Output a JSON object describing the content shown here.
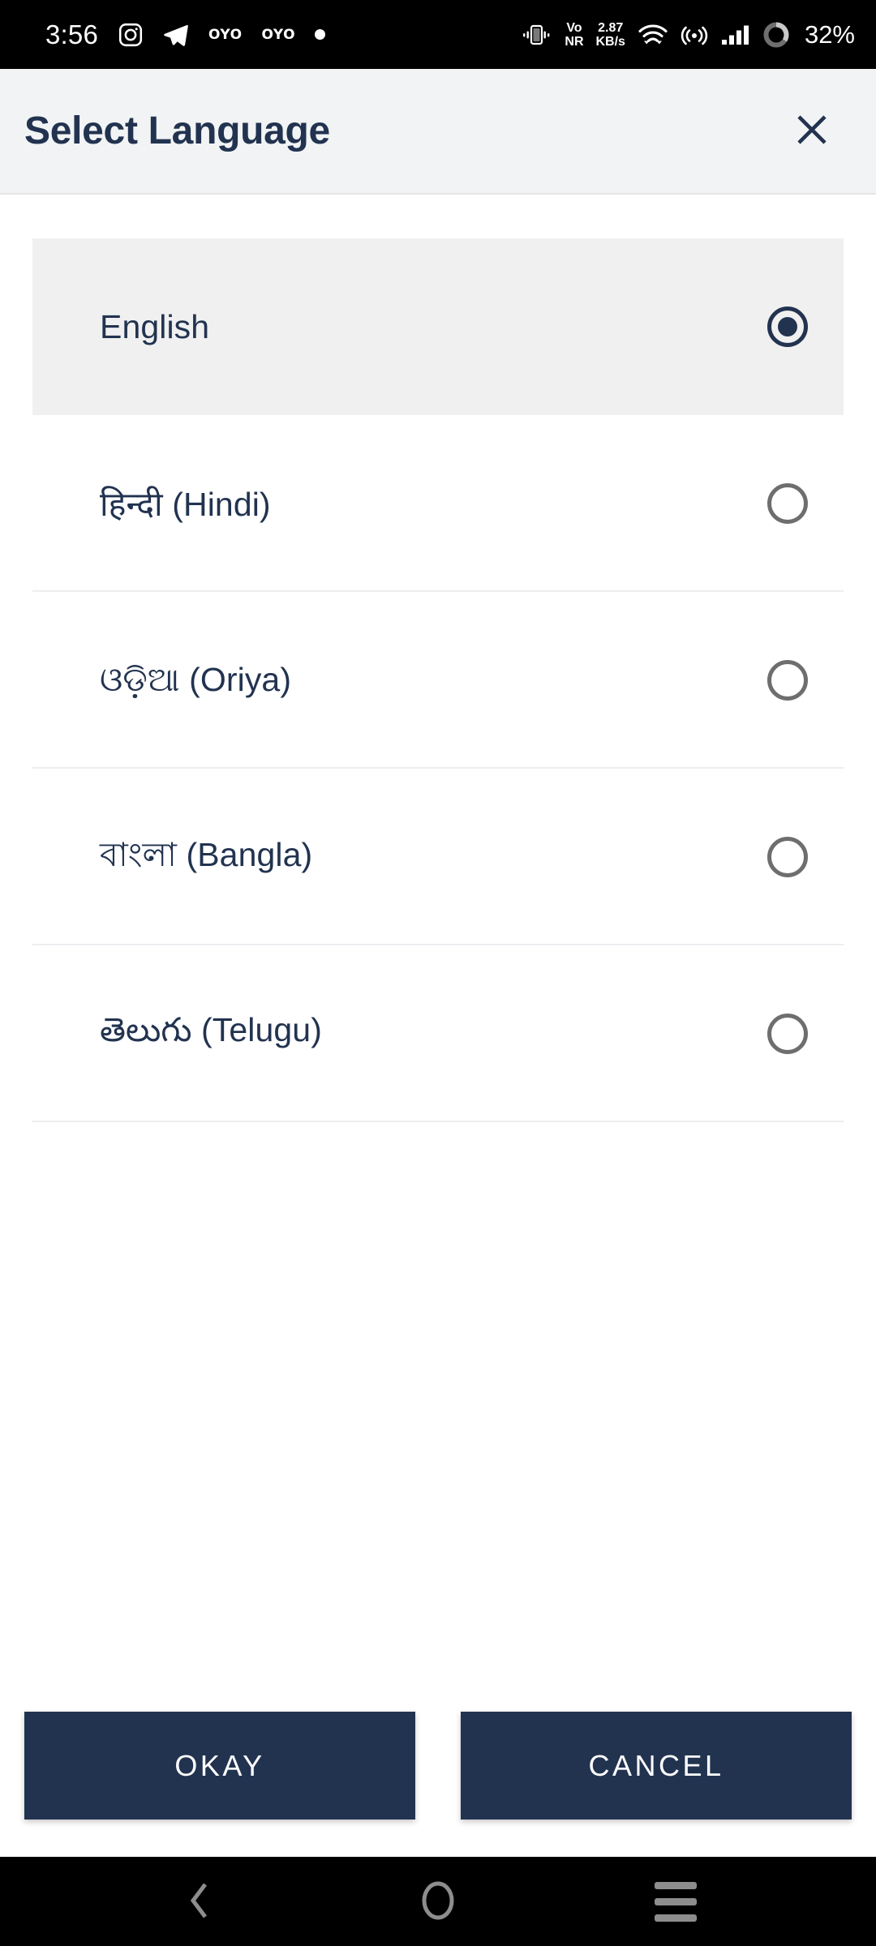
{
  "status_bar": {
    "clock": "3:56",
    "icons_left": [
      {
        "name": "instagram-icon"
      },
      {
        "name": "telegram-icon"
      },
      {
        "name": "oyo-notification-icon",
        "label": "OYO"
      },
      {
        "name": "oyo-notification-icon-2",
        "label": "OYO"
      },
      {
        "name": "generic-notification-dot-icon"
      }
    ],
    "vibrate_icon": "vibrate-icon",
    "volte_label_top": "Vo",
    "volte_label_bottom": "NR",
    "net_speed_value": "2.87",
    "net_speed_unit": "KB/s",
    "wifi_icon": "wifi-icon",
    "hotspot_icon": "hotspot-icon",
    "signal_icon": "cellular-signal-icon",
    "battery_icon": "battery-ring-icon",
    "battery_percent": "32%"
  },
  "dialog": {
    "title": "Select Language",
    "close_icon": "close-icon"
  },
  "languages": [
    {
      "label": "English",
      "selected": true
    },
    {
      "label": "हिन्दी (Hindi)",
      "selected": false
    },
    {
      "label": "ଓଡ଼ିଆ (Oriya)",
      "selected": false
    },
    {
      "label": "বাংলা (Bangla)",
      "selected": false
    },
    {
      "label": "తెలుగు (Telugu)",
      "selected": false
    }
  ],
  "footer": {
    "okay_label": "OKAY",
    "cancel_label": "CANCEL"
  },
  "nav_bar": {
    "back_icon": "back-chevron-icon",
    "home_icon": "home-circle-icon",
    "recents_icon": "recents-menu-icon"
  },
  "colors": {
    "brand_navy": "#223350",
    "header_bg": "#f2f3f4",
    "selected_row_bg": "#f0f0f0",
    "divider": "#eceef0",
    "radio_off": "#6e6e6e",
    "nav_icon": "#8d8d8d"
  }
}
